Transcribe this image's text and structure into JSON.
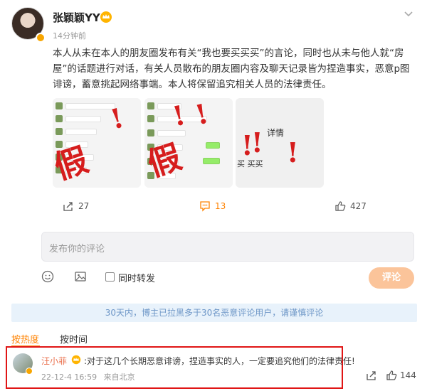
{
  "post": {
    "username": "张颖颖YY",
    "time": "14分钟前",
    "text": "本人从未在本人的朋友圈发布有关“我也要买买买”的言论，同时也从未与他人就“房屋”的话题进行对话，有关人员散布的朋友圈内容及聊天记录皆为捏造事实，恶意p图诽谤，蓄意挑起网络事端。本人将保留追究相关人员的法律责任。",
    "images": {
      "fake_char": "假",
      "thumb3_label": "详情",
      "thumb3_text": "买 买买"
    }
  },
  "actions": {
    "share_count": "27",
    "comment_count": "13",
    "like_count": "427"
  },
  "compose": {
    "placeholder": "发布你的评论",
    "repost_label": "同时转发",
    "submit_label": "评论"
  },
  "notice": "30天内，博主已拉黑多于30名恶意评论用户，请谨慎评论",
  "sort": {
    "hot": "按热度",
    "time": "按时间"
  },
  "comment": {
    "name": "汪小菲",
    "text": ":对于这几个长期恶意诽谤，捏造事实的人，一定要追究他们的法律责任!",
    "date": "22-12-4 16:59",
    "location": "来自北京",
    "likes": "144"
  },
  "colors": {
    "accent": "#ff8200",
    "highlight": "#e01515",
    "notice_bg": "#e8f2fb"
  }
}
